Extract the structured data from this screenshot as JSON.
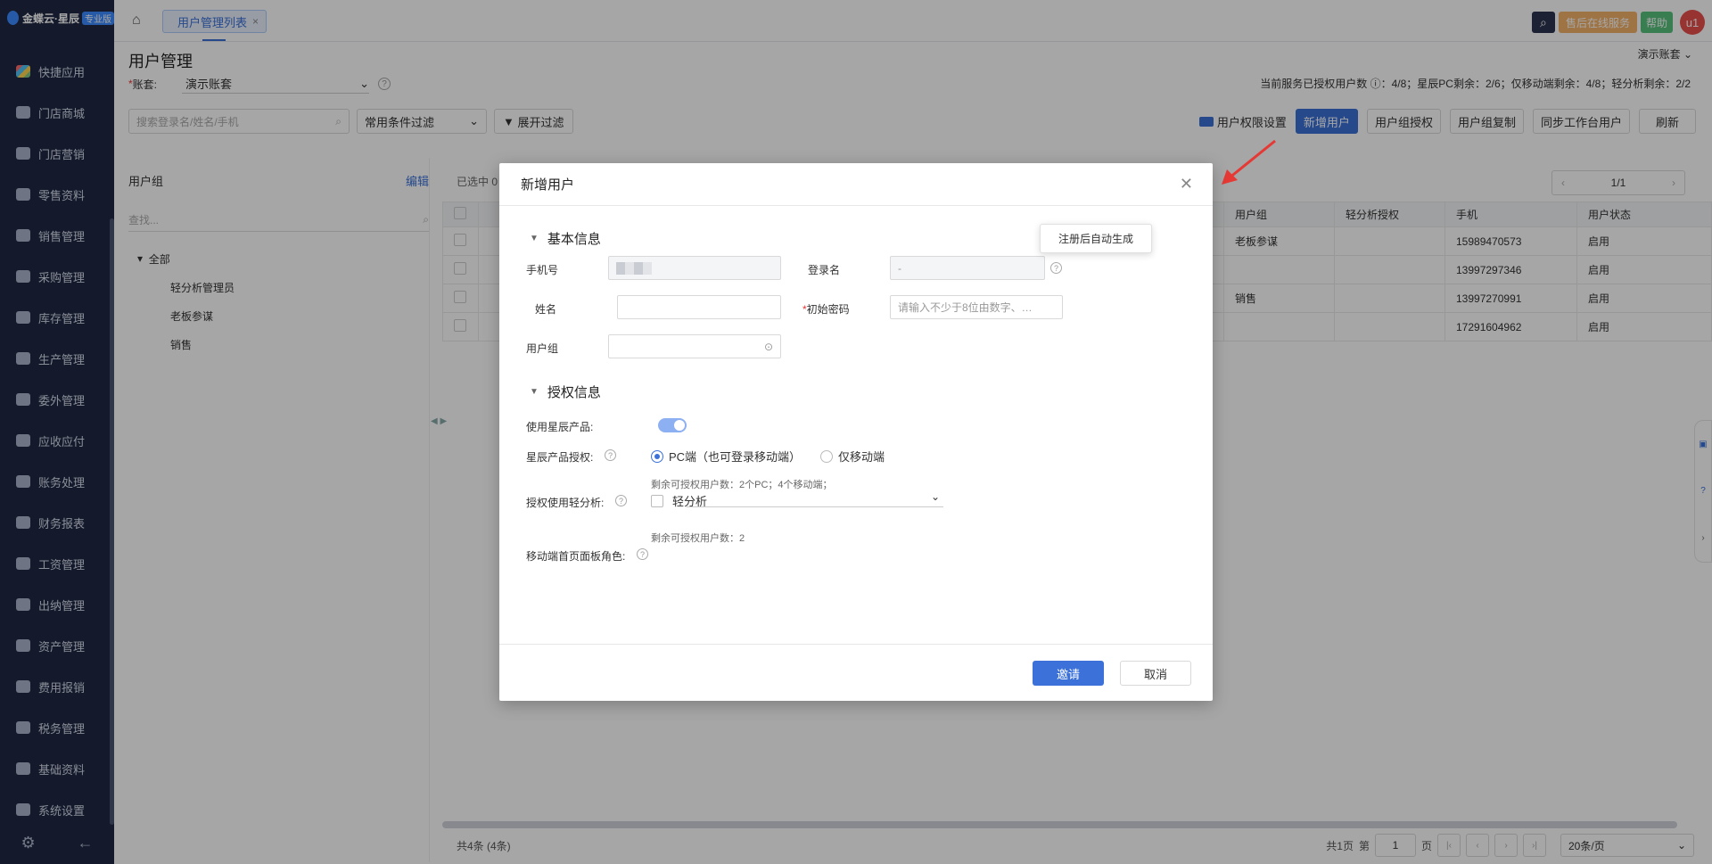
{
  "sidebar": {
    "logo": "金蝶云·星辰",
    "badge": "专业版",
    "items": [
      "快捷应用",
      "门店商城",
      "门店营销",
      "零售资料",
      "销售管理",
      "采购管理",
      "库存管理",
      "生产管理",
      "委外管理",
      "应收应付",
      "账务处理",
      "财务报表",
      "工资管理",
      "出纳管理",
      "资产管理",
      "费用报销",
      "税务管理",
      "基础资料",
      "系统设置"
    ]
  },
  "topbar": {
    "tab": "用户管理列表",
    "service": "售后在线服务",
    "help": "帮助",
    "avatar": "u1"
  },
  "page": {
    "title": "用户管理",
    "account_top": "演示账套",
    "account_label": "账套:",
    "account_value": "演示账套",
    "quota": "当前服务已授权用户数 ⓘ：4/8；星辰PC剩余：2/6；仅移动端剩余：4/8；轻分析剩余：2/2",
    "search_placeholder": "搜索登录名/姓名/手机",
    "filter_select": "常用条件过滤",
    "expand_filter": "展开过滤",
    "actions": {
      "perm": "用户权限设置",
      "add": "新增用户",
      "grp_auth": "用户组授权",
      "grp_copy": "用户组复制",
      "sync": "同步工作台用户",
      "refresh": "刷新"
    }
  },
  "groups": {
    "title": "用户组",
    "edit": "编辑",
    "find": "查找...",
    "root": "全部",
    "children": [
      "轻分析管理员",
      "老板参谋",
      "销售"
    ]
  },
  "table": {
    "selected": "已选中 0",
    "pager": "1/1",
    "headers": [
      "用户组",
      "轻分析授权",
      "手机",
      "用户状态"
    ],
    "rows": [
      [
        "老板参谋",
        "",
        "15989470573",
        "启用"
      ],
      [
        "",
        "",
        "13997297346",
        "启用"
      ],
      [
        "销售",
        "",
        "13997270991",
        "启用"
      ],
      [
        "",
        "",
        "17291604962",
        "启用"
      ]
    ],
    "total": "共4条 (4条)",
    "pages": "共1页",
    "di": "第",
    "page_no": "1",
    "ye": "页",
    "page_size": "20条/页"
  },
  "modal": {
    "title": "新增用户",
    "basic": "基本信息",
    "phone_label": "手机号",
    "login_label": "登录名",
    "login_value": "-",
    "tip": "注册后自动生成",
    "name_label": "姓名",
    "pwd_label": "初始密码",
    "pwd_placeholder": "请输入不少于8位由数字、…",
    "grp_label": "用户组",
    "auth": "授权信息",
    "use_label": "使用星辰产品:",
    "prod_label": "星辰产品授权:",
    "pc_option": "PC端（也可登录移动端）",
    "mobile_option": "仅移动端",
    "remain1": "剩余可授权用户数：2个PC；4个移动端；",
    "light_label": "授权使用轻分析:",
    "light_option": "轻分析",
    "remain2": "剩余可授权用户数：2",
    "mobile_role_label": "移动端首页面板角色:",
    "ok": "邀请",
    "cancel": "取消"
  }
}
